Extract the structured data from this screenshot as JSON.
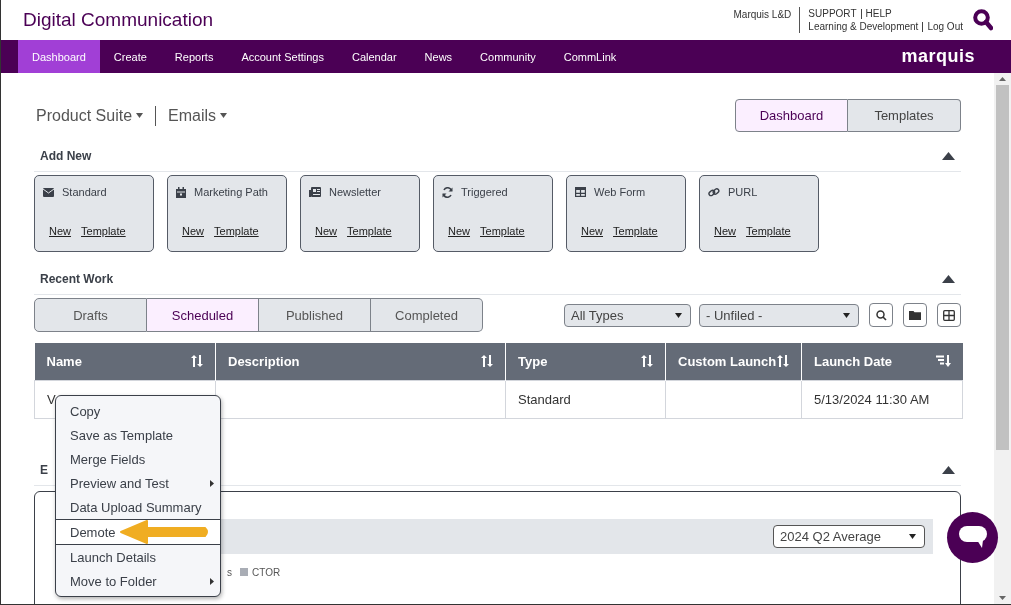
{
  "header": {
    "title": "Digital Communication",
    "user": "Marquis L&D",
    "links_top": [
      "SUPPORT",
      "HELP"
    ],
    "links_bottom": [
      "Learning & Development",
      "Log Out"
    ]
  },
  "nav": {
    "items": [
      {
        "label": "Dashboard",
        "selected": true
      },
      {
        "label": "Create",
        "selected": false
      },
      {
        "label": "Reports",
        "selected": false
      },
      {
        "label": "Account Settings",
        "selected": false
      },
      {
        "label": "Calendar",
        "selected": false
      },
      {
        "label": "News",
        "selected": false
      },
      {
        "label": "Community",
        "selected": false
      },
      {
        "label": "CommLink",
        "selected": false
      }
    ],
    "logo": "marquis"
  },
  "breadcrumbs": [
    "Product Suite",
    "Emails"
  ],
  "view_toggle": [
    {
      "label": "Dashboard",
      "selected": true
    },
    {
      "label": "Templates",
      "selected": false
    }
  ],
  "add_new": {
    "title": "Add New",
    "expanded": true,
    "cards": [
      {
        "label": "Standard",
        "kind": "envelope",
        "links": [
          "New",
          "Template"
        ]
      },
      {
        "label": "Marketing Path",
        "kind": "calendar",
        "links": [
          "New",
          "Template"
        ]
      },
      {
        "label": "Newsletter",
        "kind": "newspaper",
        "links": [
          "New",
          "Template"
        ]
      },
      {
        "label": "Triggered",
        "kind": "refresh",
        "links": [
          "New",
          "Template"
        ]
      },
      {
        "label": "Web Form",
        "kind": "table",
        "links": [
          "New",
          "Template"
        ]
      },
      {
        "label": "PURL",
        "kind": "link",
        "links": [
          "New",
          "Template"
        ]
      }
    ]
  },
  "recent_work": {
    "title": "Recent Work",
    "expanded": true,
    "tabs": [
      {
        "label": "Drafts",
        "selected": false
      },
      {
        "label": "Scheduled",
        "selected": true
      },
      {
        "label": "Published",
        "selected": false
      },
      {
        "label": "Completed",
        "selected": false
      }
    ],
    "filters": [
      {
        "value": "All Types"
      },
      {
        "value": "- Unfiled -"
      }
    ],
    "columns": [
      {
        "label": "Name",
        "sorted": false
      },
      {
        "label": "Description",
        "sorted": false
      },
      {
        "label": "Type",
        "sorted": false
      },
      {
        "label": "Custom Launch",
        "sorted": false
      },
      {
        "label": "Launch Date",
        "sorted": true
      }
    ],
    "rows": [
      [
        "V",
        "",
        "Standard",
        "",
        "5/13/2024 11:30 AM"
      ]
    ]
  },
  "email_section": {
    "title": "E",
    "expanded": true,
    "period": "2024 Q2 Average",
    "legend": [
      {
        "label": "s",
        "swatch": false
      },
      {
        "label": "CTOR",
        "swatch": true
      }
    ]
  },
  "context_menu": {
    "items": [
      {
        "label": "Copy",
        "submenu": false,
        "highlighted": false
      },
      {
        "label": "Save as Template",
        "submenu": false,
        "highlighted": false
      },
      {
        "label": "Merge Fields",
        "submenu": false,
        "highlighted": false
      },
      {
        "label": "Preview and Test",
        "submenu": true,
        "highlighted": false
      },
      {
        "label": "Data Upload Summary",
        "submenu": false,
        "highlighted": false
      },
      {
        "label": "Demote",
        "submenu": false,
        "highlighted": true
      },
      {
        "label": "Launch Details",
        "submenu": false,
        "highlighted": false
      },
      {
        "label": "Move to Folder",
        "submenu": true,
        "highlighted": false
      }
    ]
  }
}
